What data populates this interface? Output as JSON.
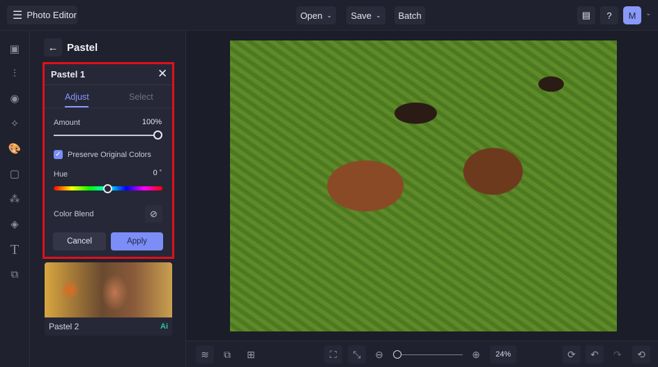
{
  "header": {
    "app_title": "Photo Editor",
    "open": "Open",
    "save": "Save",
    "batch": "Batch",
    "avatar": "M"
  },
  "panel": {
    "title": "Pastel",
    "card": {
      "title": "Pastel 1",
      "tabs": [
        "Adjust",
        "Select"
      ],
      "amount_label": "Amount",
      "amount_value": "100%",
      "amount": 100,
      "preserve_label": "Preserve Original Colors",
      "preserve_checked": true,
      "hue_label": "Hue",
      "hue_value": "0",
      "hue_unit": "°",
      "color_blend_label": "Color Blend",
      "cancel": "Cancel",
      "apply": "Apply"
    },
    "preset2": {
      "title": "Pastel 2",
      "badge": "Ai"
    }
  },
  "footer": {
    "zoom": "24%"
  },
  "colors": {
    "accent": "#7b8ef7",
    "highlight": "#e0101a",
    "ai_badge": "#2ec4a0"
  }
}
